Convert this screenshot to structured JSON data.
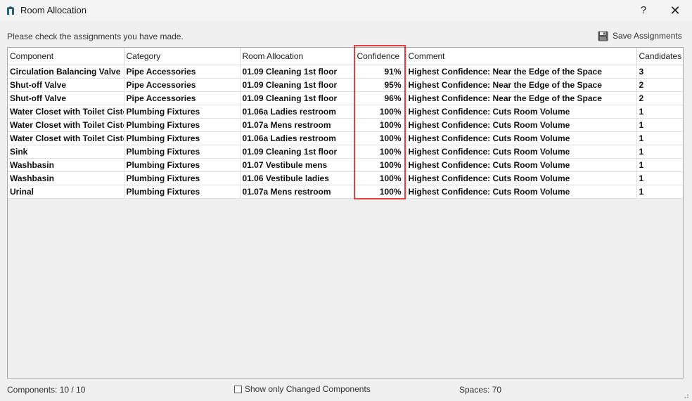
{
  "window": {
    "title": "Room Allocation",
    "help_label": "?",
    "close_label": "✕"
  },
  "toolbar": {
    "instruction": "Please check the assignments you have made.",
    "save_label": "Save Assignments"
  },
  "table": {
    "columns": [
      "Component",
      "Category",
      "Room Allocation",
      "Confidence",
      "Comment",
      "Candidates"
    ],
    "rows": [
      [
        "Circulation Balancing Valve",
        "Pipe Accessories",
        "01.09 Cleaning 1st floor",
        "91%",
        "Highest Confidence: Near the Edge of the Space",
        "3"
      ],
      [
        "Shut-off Valve",
        "Pipe Accessories",
        "01.09 Cleaning 1st floor",
        "95%",
        "Highest Confidence: Near the Edge of the Space",
        "2"
      ],
      [
        "Shut-off Valve",
        "Pipe Accessories",
        "01.09 Cleaning 1st floor",
        "96%",
        "Highest Confidence: Near the Edge of the Space",
        "2"
      ],
      [
        "Water Closet with Toilet Ciste",
        "Plumbing Fixtures",
        "01.06a Ladies restroom",
        "100%",
        "Highest Confidence: Cuts Room Volume",
        "1"
      ],
      [
        "Water Closet with Toilet Ciste",
        "Plumbing Fixtures",
        "01.07a Mens restroom",
        "100%",
        "Highest Confidence: Cuts Room Volume",
        "1"
      ],
      [
        "Water Closet with Toilet Ciste",
        "Plumbing Fixtures",
        "01.06a Ladies restroom",
        "100%",
        "Highest Confidence: Cuts Room Volume",
        "1"
      ],
      [
        "Sink",
        "Plumbing Fixtures",
        "01.09 Cleaning 1st floor",
        "100%",
        "Highest Confidence: Cuts Room Volume",
        "1"
      ],
      [
        "Washbasin",
        "Plumbing Fixtures",
        "01.07 Vestibule mens",
        "100%",
        "Highest Confidence: Cuts Room Volume",
        "1"
      ],
      [
        "Washbasin",
        "Plumbing Fixtures",
        "01.06 Vestibule ladies",
        "100%",
        "Highest Confidence: Cuts Room Volume",
        "1"
      ],
      [
        "Urinal",
        "Plumbing Fixtures",
        "01.07a Mens restroom",
        "100%",
        "Highest Confidence: Cuts Room Volume",
        "1"
      ]
    ]
  },
  "footer": {
    "components": "Components: 10 / 10",
    "checkbox_label": "Show only Changed Components",
    "checkbox_checked": false,
    "spaces": "Spaces: 70"
  },
  "colors": {
    "highlight": "#e04040",
    "background": "#f0f0f0",
    "app_icon": "#2b5f72"
  },
  "icons": [
    "app-icon",
    "save-disk-icon",
    "resize-grip-icon"
  ]
}
